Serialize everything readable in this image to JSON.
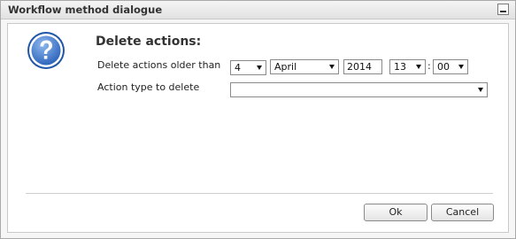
{
  "window": {
    "title": "Workflow method dialogue"
  },
  "content": {
    "heading": "Delete actions:",
    "icon": "question-help-icon",
    "delete_older_label": "Delete actions older than",
    "action_type_label": "Action type to delete",
    "date": {
      "day": "4",
      "month": "April",
      "year": "2014",
      "hour": "13",
      "minute": "00",
      "separator": ":"
    },
    "action_type_value": ""
  },
  "buttons": {
    "ok": "Ok",
    "cancel": "Cancel"
  },
  "colors": {
    "accent": "#3b78c9",
    "panel_border": "#c9c9c9"
  }
}
